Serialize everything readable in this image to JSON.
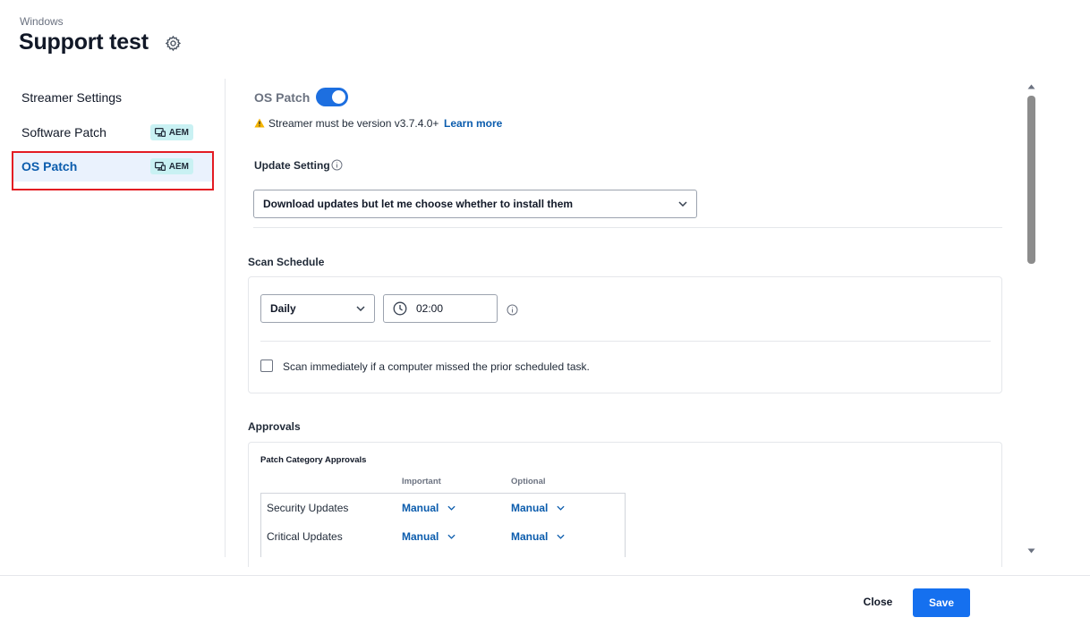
{
  "header": {
    "breadcrumb": "Windows",
    "title": "Support test",
    "settings_icon": "gear-icon"
  },
  "sidebar": {
    "items": [
      {
        "label": "Streamer Settings",
        "badge": ""
      },
      {
        "label": "Software Patch",
        "badge": "AEM"
      },
      {
        "label": "OS Patch",
        "badge": "AEM",
        "active": true
      }
    ]
  },
  "os_patch": {
    "label": "OS Patch",
    "enabled": true,
    "warning": "Streamer must be version v3.7.4.0+",
    "learn_more": "Learn more"
  },
  "update_setting": {
    "label": "Update Setting",
    "value": "Download updates but let me choose whether to install them"
  },
  "scan_schedule": {
    "label": "Scan Schedule",
    "frequency": "Daily",
    "time": "02:00",
    "missed_scan_label": "Scan immediately if a computer missed the prior scheduled task.",
    "missed_scan_checked": false
  },
  "approvals": {
    "label": "Approvals",
    "table_title": "Patch Category Approvals",
    "columns": [
      "Important",
      "Optional"
    ],
    "rows": [
      {
        "category": "Security Updates",
        "important": "Manual",
        "optional": "Manual"
      },
      {
        "category": "Critical Updates",
        "important": "Manual",
        "optional": "Manual"
      }
    ]
  },
  "footer": {
    "close_label": "Close",
    "save_label": "Save"
  },
  "colors": {
    "accent": "#1570ef",
    "link": "#0b5cad",
    "active_nav_bg": "#eaf2fd",
    "badge_bg": "#c9f1f3",
    "highlight": "#e31b23"
  }
}
